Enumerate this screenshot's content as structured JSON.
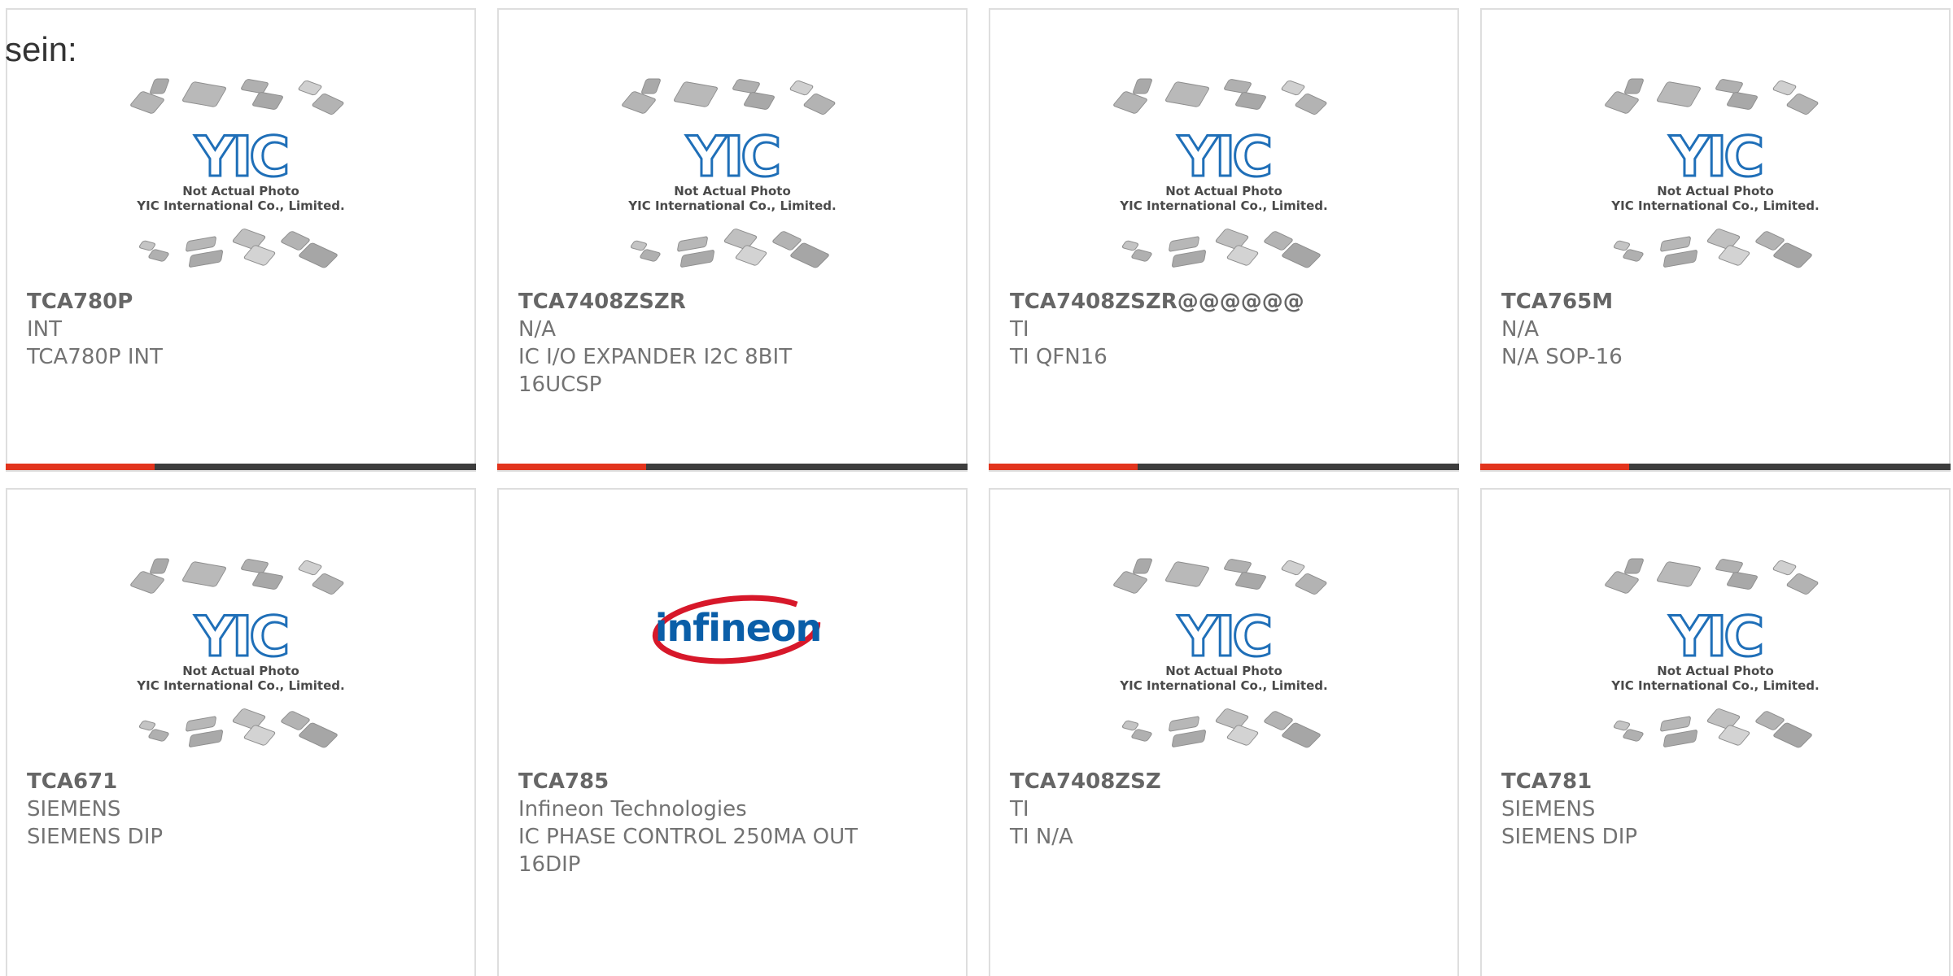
{
  "page": {
    "lead_text": "sein:"
  },
  "placeholder_photo": {
    "caption_line1": "Not Actual Photo",
    "caption_line2": "YIC International Co., Limited.",
    "logo_text": "YIC"
  },
  "brand_logo": {
    "text": "infineon"
  },
  "colors": {
    "accent": "#e2341d",
    "bar": "#3d3d3d",
    "border": "#dedede",
    "logo_blue": "#1f6fb8",
    "infineon_red": "#d7182a",
    "infineon_blue": "#0a5ea8"
  },
  "products": [
    {
      "part_number": "TCA780P",
      "manufacturer": "INT",
      "description": "TCA780P INT",
      "description_2": "",
      "image": "yic-placeholder",
      "has_bar": true
    },
    {
      "part_number": "TCA7408ZSZR",
      "manufacturer": "N/A",
      "description": "IC I/O EXPANDER I2C 8BIT",
      "description_2": "16UCSP",
      "image": "yic-placeholder",
      "has_bar": true
    },
    {
      "part_number": "TCA7408ZSZR@@@@@@",
      "manufacturer": "TI",
      "description": "TI QFN16",
      "description_2": "",
      "image": "yic-placeholder",
      "has_bar": true
    },
    {
      "part_number": "TCA765M",
      "manufacturer": "N/A",
      "description": "N/A SOP-16",
      "description_2": "",
      "image": "yic-placeholder",
      "has_bar": true
    },
    {
      "part_number": "TCA671",
      "manufacturer": "SIEMENS",
      "description": "SIEMENS DIP",
      "description_2": "",
      "image": "yic-placeholder",
      "has_bar": false
    },
    {
      "part_number": "TCA785",
      "manufacturer": "Infineon Technologies",
      "description": "IC PHASE CONTROL 250MA OUT",
      "description_2": "16DIP",
      "image": "infineon-logo",
      "has_bar": false
    },
    {
      "part_number": "TCA7408ZSZ",
      "manufacturer": "TI",
      "description": "TI N/A",
      "description_2": "",
      "image": "yic-placeholder",
      "has_bar": false
    },
    {
      "part_number": "TCA781",
      "manufacturer": "SIEMENS",
      "description": "SIEMENS DIP",
      "description_2": "",
      "image": "yic-placeholder",
      "has_bar": false
    }
  ]
}
